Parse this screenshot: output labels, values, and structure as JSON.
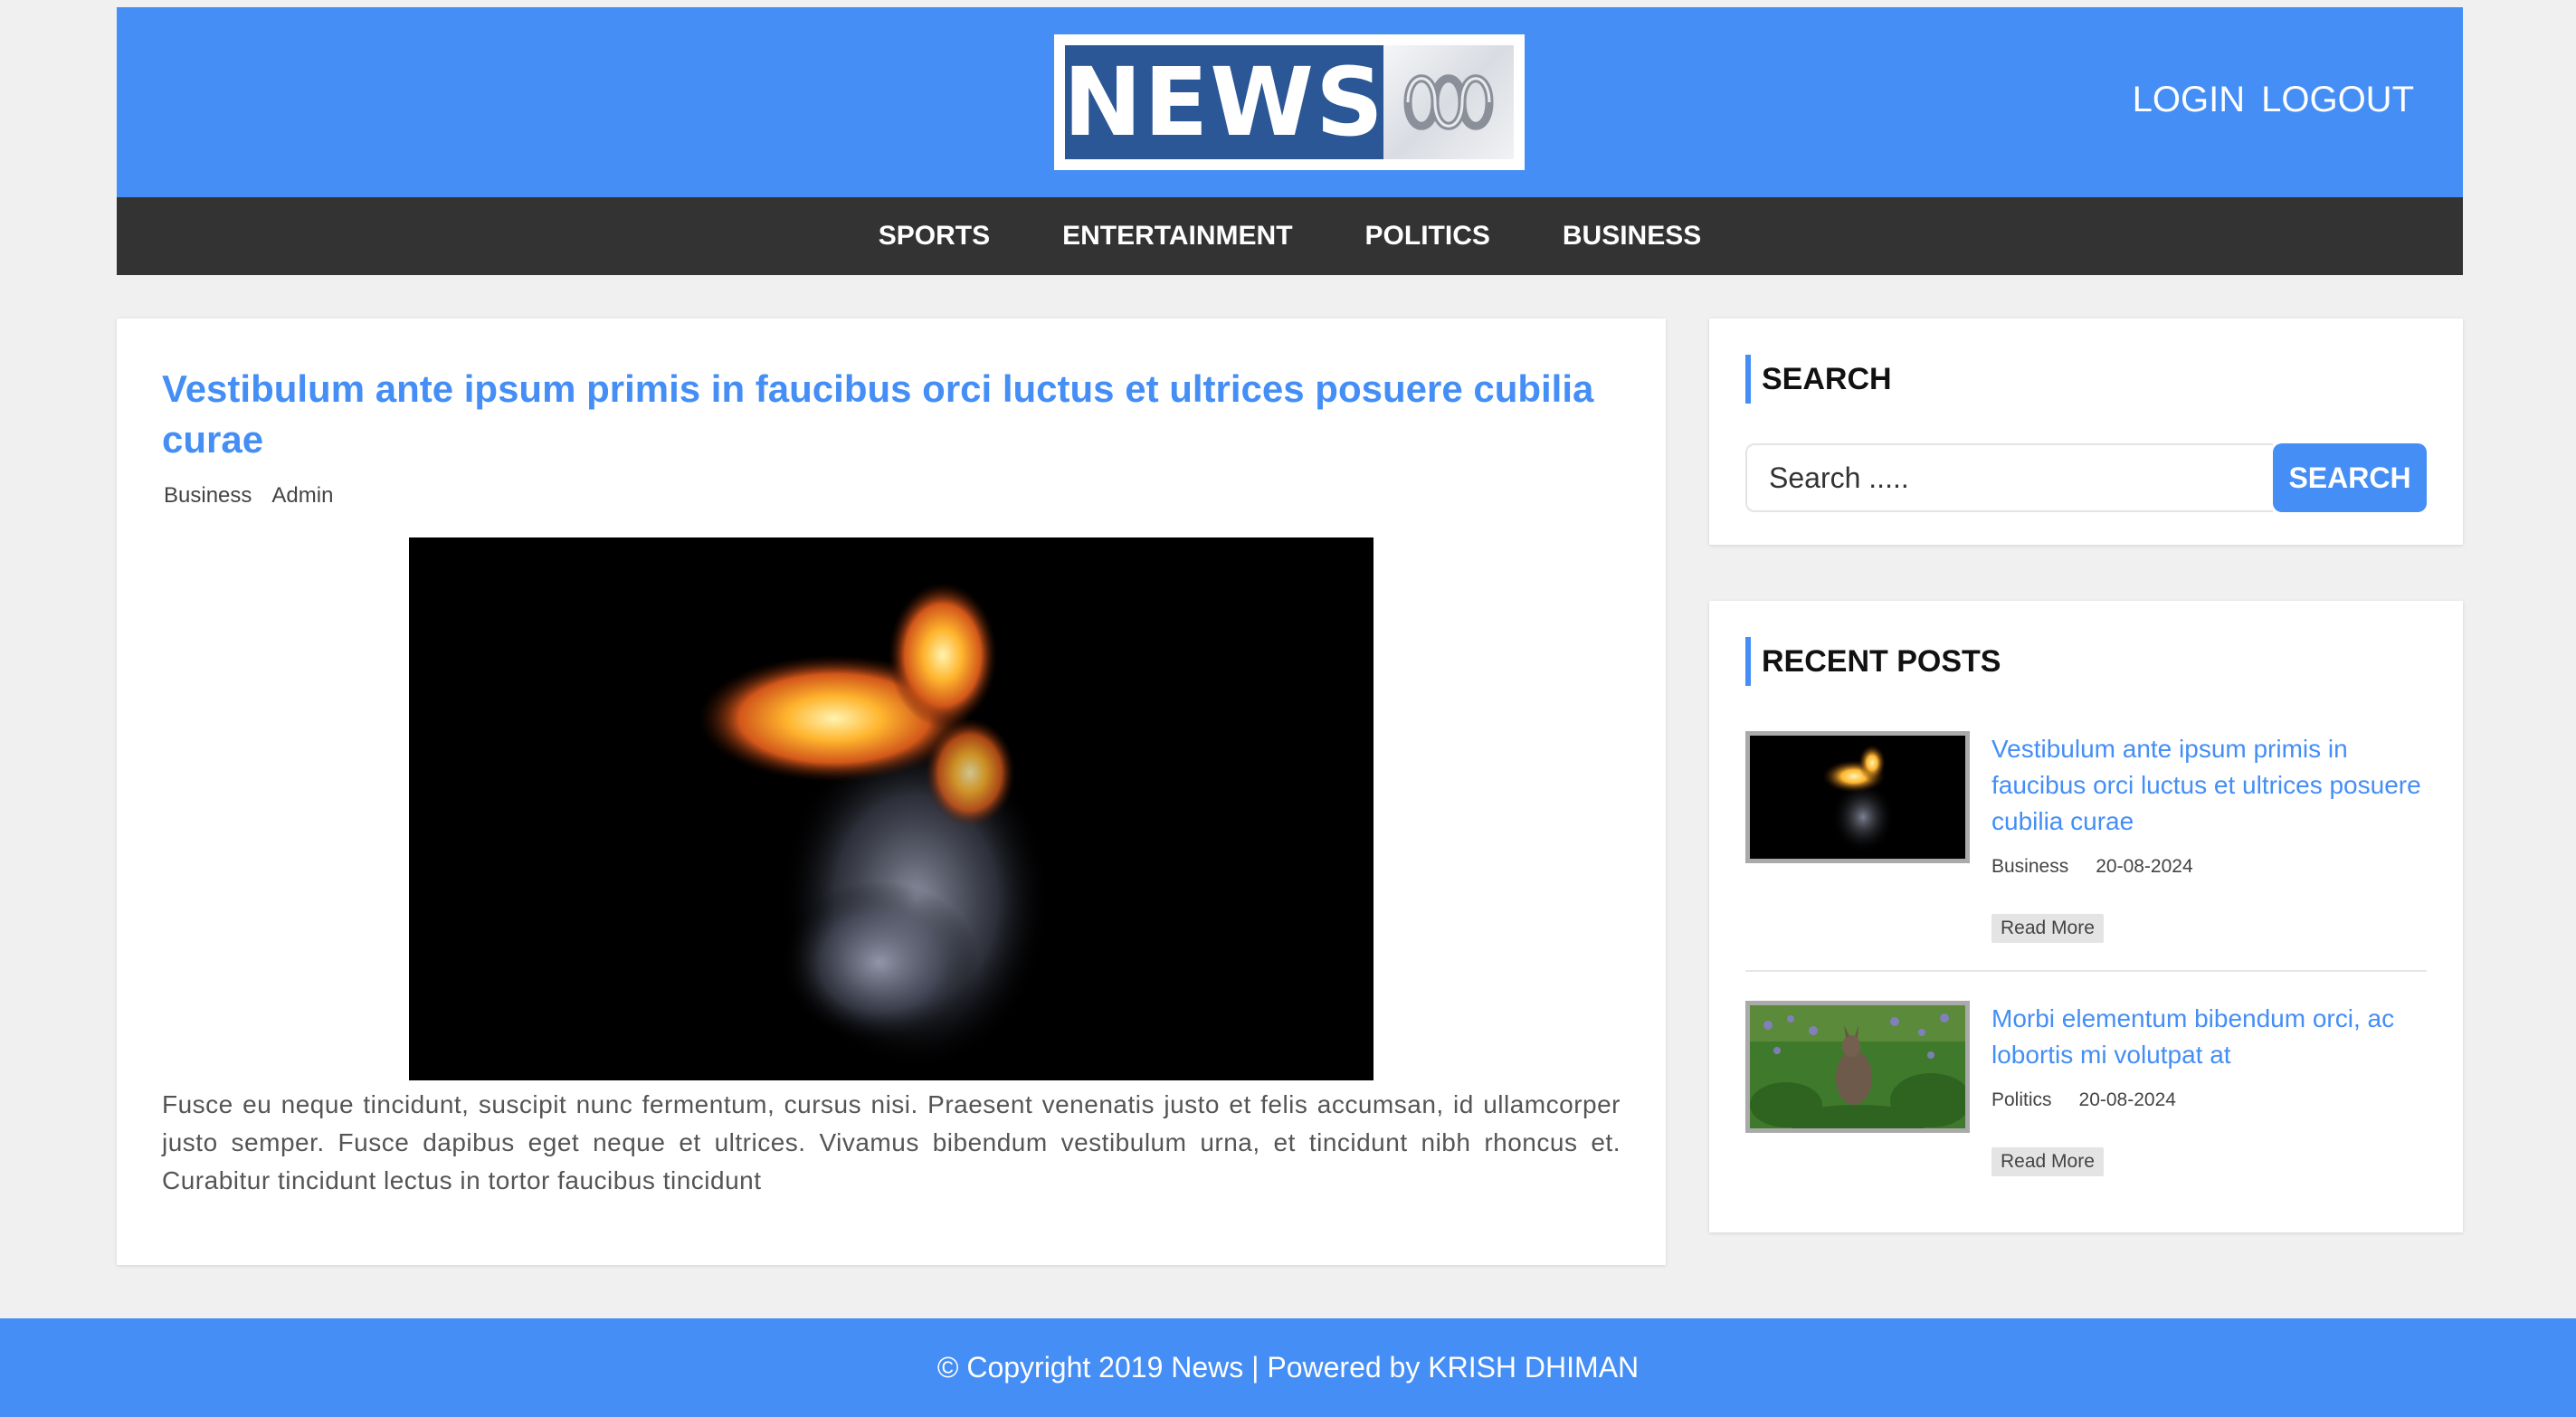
{
  "header": {
    "logo_text": "NEWS",
    "logo_mark_icon": "abc-lissajous-icon",
    "login_label": "LOGIN",
    "logout_label": "LOGOUT"
  },
  "nav": {
    "items": [
      {
        "label": "SPORTS"
      },
      {
        "label": "ENTERTAINMENT"
      },
      {
        "label": "POLITICS"
      },
      {
        "label": "BUSINESS"
      }
    ]
  },
  "post": {
    "title": "Vestibulum ante ipsum primis in faucibus orci luctus et ultrices posuere cubilia curae",
    "category": "Business",
    "author": "Admin",
    "body": "Fusce eu neque tincidunt, suscipit nunc fermentum, cursus nisi. Praesent venenatis justo et felis accumsan, id ullamcorper justo semper. Fusce dapibus eget neque et ultrices. Vivamus bibendum vestibulum urna, et tincidunt nibh rhoncus et. Curabitur tincidunt lectus in tortor faucibus tincidunt"
  },
  "sidebar": {
    "search": {
      "title": "SEARCH",
      "placeholder": "Search .....",
      "button_label": "SEARCH"
    },
    "recent": {
      "title": "RECENT POSTS",
      "posts": [
        {
          "title": "Vestibulum ante ipsum primis in faucibus orci luctus et ultrices posuere cubilia curae",
          "category": "Business",
          "date": "20-08-2024",
          "read_more": "Read More"
        },
        {
          "title": "Morbi elementum bibendum orci, ac lobortis mi volutpat at",
          "category": "Politics",
          "date": "20-08-2024",
          "read_more": "Read More"
        }
      ]
    }
  },
  "footer": {
    "text": "© Copyright 2019 News | Powered by KRISH DHIMAN"
  },
  "colors": {
    "accent": "#448ef6",
    "nav_bg": "#333333",
    "logo_bg": "#2b5797"
  }
}
